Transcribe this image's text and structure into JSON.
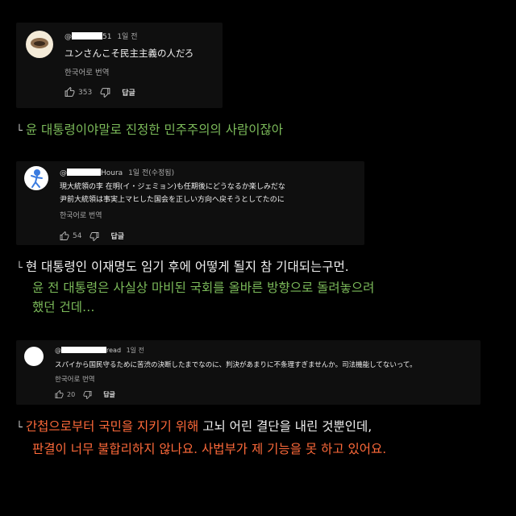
{
  "comments": [
    {
      "handle_prefix": "@",
      "handle_suffix": "51",
      "time": "1일 전",
      "text": [
        "ユンさんこそ民主主義の人だろ"
      ],
      "translate_label": "한국어로 번역",
      "likes": "353",
      "reply_label": "답글"
    },
    {
      "handle_prefix": "@",
      "handle_suffix": "Houra",
      "time": "1일 전(수정됨)",
      "text": [
        "現大統領の李 在明(イ・ジェミョン)も任期後にどうなるか楽しみだな",
        "尹前大統領は事実上マヒした国会を正しい方向へ戻そうとしてたのに"
      ],
      "translate_label": "한국어로 번역",
      "likes": "54",
      "reply_label": "답글"
    },
    {
      "handle_prefix": "@",
      "handle_suffix": "read",
      "time": "1일 전",
      "text": [
        "スパイから国民守るために苦渋の決断したまでなのに、判決があまりに不条理すぎませんか。司法機能してないって。"
      ],
      "translate_label": "한국어로 번역",
      "likes": "20",
      "reply_label": "답글"
    }
  ],
  "captions": {
    "corner": "└",
    "c1": "윤 대통령이야말로 진정한 민주주의의 사람이잖아",
    "c2_line1": "현 대통령인 이재명도 임기 후에 어떻게 될지 참 기대되는구먼.",
    "c2_line2": "윤 전 대통령은 사실상 마비된 국회를 올바른 방향으로 돌려놓으려",
    "c2_line3": "했던 건데…",
    "c3_line1_a": "간첩으로부터 국민을 지키기 위해",
    "c3_line1_b": "고뇌 어린 결단을 내린 것뿐인데,",
    "c3_line2": "판결이 너무 불합리하지 않나요. 사법부가 제 기능을 못 하고 있어요."
  },
  "colors": {
    "green": "#7cbb5a",
    "orange": "#ff6a3a",
    "card_bg": "#0f0f0f"
  },
  "icons": [
    "thumbs-up-icon",
    "thumbs-down-icon"
  ]
}
